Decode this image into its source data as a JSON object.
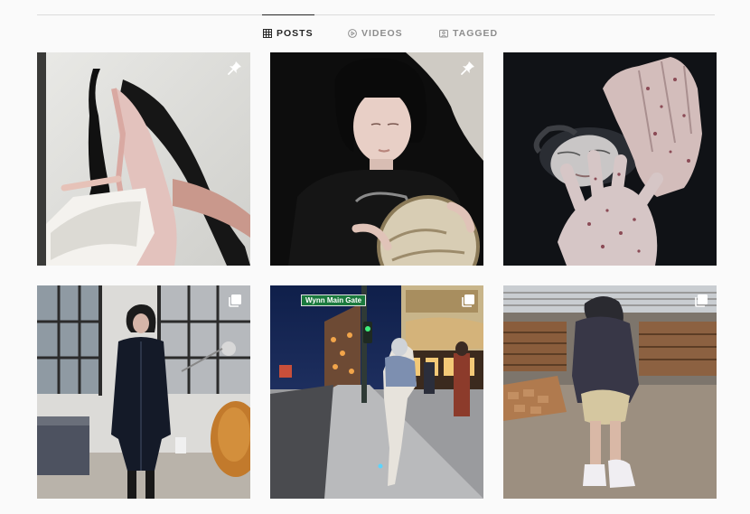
{
  "tabs": [
    {
      "label": "POSTS",
      "icon": "grid-icon",
      "active": true
    },
    {
      "label": "VIDEOS",
      "icon": "play-circle-icon",
      "active": false
    },
    {
      "label": "TAGGED",
      "icon": "tagged-icon",
      "active": false
    }
  ],
  "posts": [
    {
      "subject": "woman in sheer dress posing against white studio wall",
      "badge": "pin-icon",
      "pinned": true
    },
    {
      "subject": "girl with bangs in black t-shirt holding a globe",
      "badge": "pin-icon",
      "pinned": true
    },
    {
      "subject": "woman lying down with paint-speckled hands",
      "badge": null,
      "pinned": false
    },
    {
      "subject": "woman in black trench coat in loft apartment",
      "badge": "carousel-icon",
      "pinned": false
    },
    {
      "subject": "woman walking on Las Vegas street at night",
      "badge": "carousel-icon",
      "pinned": false,
      "sign_text": "Wynn Main Gate"
    },
    {
      "subject": "woman in hoodie on construction site with lumber",
      "badge": "carousel-icon",
      "pinned": false
    }
  ],
  "colors": {
    "background": "#fafafa",
    "active_tab": "#262626",
    "inactive_tab": "#8e8e8e",
    "divider": "#dbdbdb"
  }
}
